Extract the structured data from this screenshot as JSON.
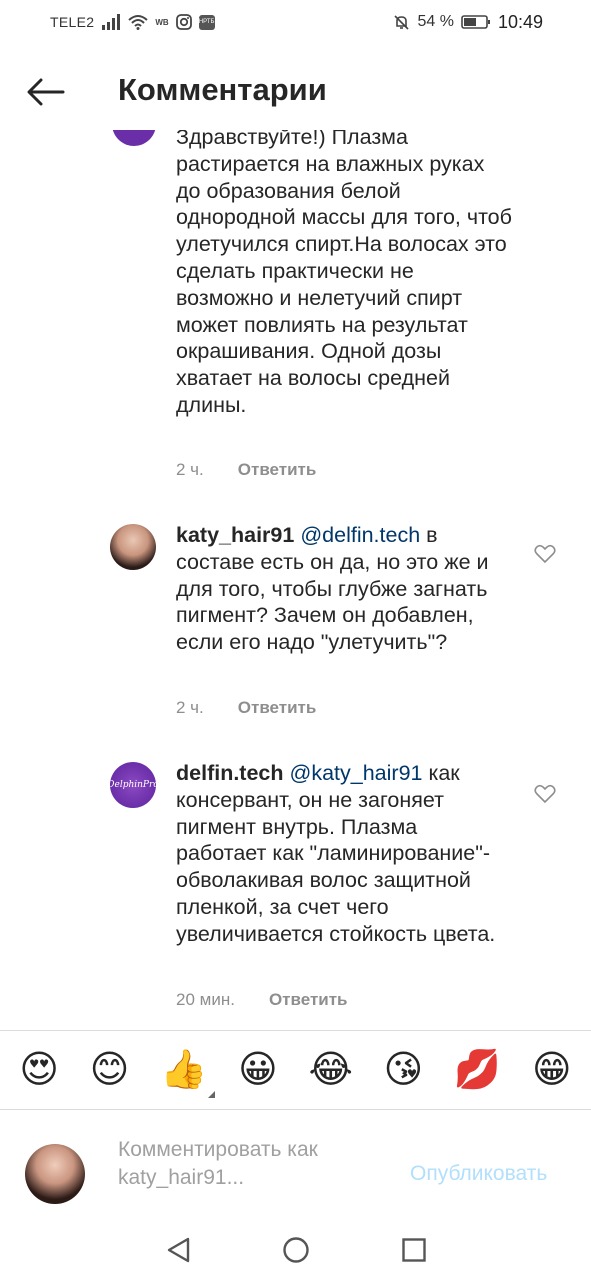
{
  "status_bar": {
    "carrier": "TELE2",
    "wb_label": "WB",
    "mini_badge": "НРТБ",
    "battery_pct": "54 %",
    "time": "10:49"
  },
  "header": {
    "title": "Комментарии"
  },
  "comments": [
    {
      "username": "",
      "mention": "",
      "text": "Здравствуйте!) Плазма растирается на влажных руках до образования белой однородной массы для того, чтоб улетучился спирт.На волосах это сделать практически не возможно и нелетучий спирт может повлиять на результат окрашивания. Одной дозы хватает на волосы средней длины.",
      "time": "2 ч.",
      "reply_label": "Ответить"
    },
    {
      "username": "katy_hair91",
      "mention": "@delfin.tech",
      "text": "в составе есть он да, но это же и для того, чтобы глубже загнать пигмент? Зачем он добавлен, если его надо \"улетучить\"?",
      "time": "2 ч.",
      "reply_label": "Ответить"
    },
    {
      "username": "delfin.tech",
      "mention": "@katy_hair91",
      "text": "как консервант, он не загоняет пигмент внутрь. Плазма работает как \"ламинирование\"-обволакивая волос защитной пленкой, за счет чего увеличивается стойкость цвета.",
      "time": "20 мин.",
      "reply_label": "Ответить",
      "avatar_logo_text": "DelphinPro"
    }
  ],
  "emoji_bar": [
    "😍",
    "😊",
    "👍",
    "😀",
    "😂",
    "😘",
    "💋",
    "😁"
  ],
  "composer": {
    "placeholder": "Комментировать как\nkaty_hair91...",
    "publish_label": "Опубликовать"
  },
  "colors": {
    "mention": "#00376b",
    "meta": "#8e8e8e",
    "publish_disabled": "#b2dffc",
    "brand_purple": "#6a2ea8"
  }
}
